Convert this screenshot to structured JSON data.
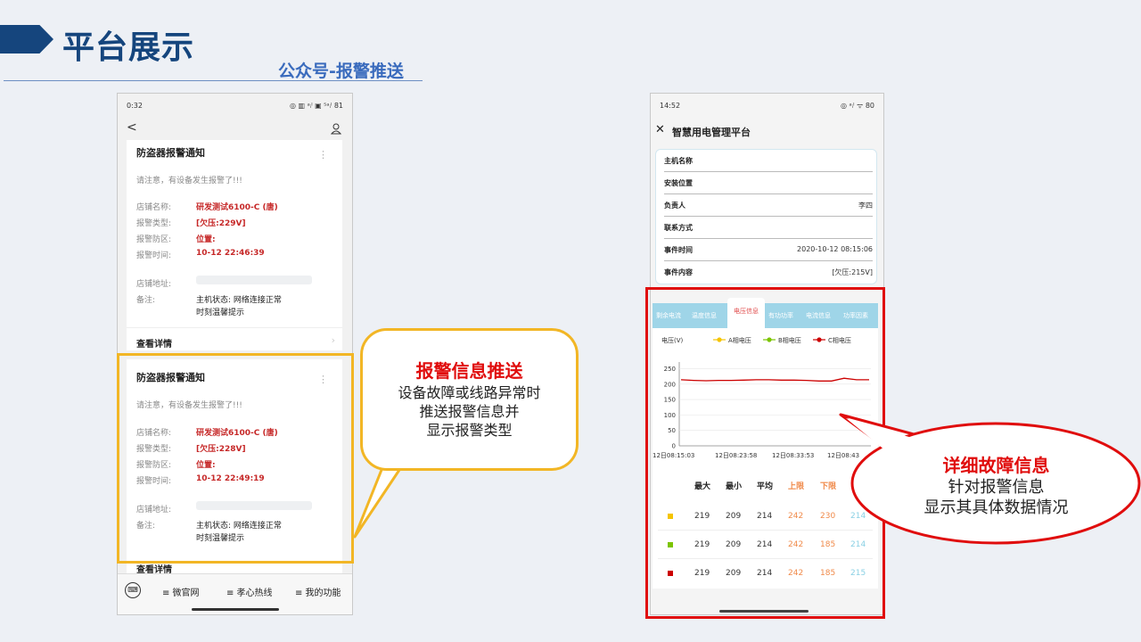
{
  "header": {
    "title": "平台展示",
    "subtitle": "公众号-报警推送"
  },
  "phone1": {
    "status_time": "0:32",
    "status_icons": "◎ ▥ ᵃᵢˡ ▣ ⁵ᵃᵢˡ 81",
    "back": "<",
    "cards": [
      {
        "title": "防盗器报警通知",
        "intro": "请注意，有设备发生报警了!!!",
        "labels": [
          "店铺名称:",
          "报警类型:",
          "报警防区:",
          "报警时间:",
          "店铺地址:",
          "备注:"
        ],
        "shop": "研发测试6100-C (唐)",
        "type": "[欠压:229V]",
        "zone": "位置:",
        "time": "10-12 22:46:39",
        "note1": "主机状态: 网络连接正常",
        "note2": "时刻温馨提示",
        "detail": "查看详情"
      },
      {
        "title": "防盗器报警通知",
        "intro": "请注意，有设备发生报警了!!!",
        "labels": [
          "店铺名称:",
          "报警类型:",
          "报警防区:",
          "报警时间:",
          "店铺地址:",
          "备注:"
        ],
        "shop": "研发测试6100-C (唐)",
        "type": "[欠压:228V]",
        "zone": "位置:",
        "time": "10-12 22:49:19",
        "note1": "主机状态: 网络连接正常",
        "note2": "时刻温馨提示",
        "detail": "查看详情"
      }
    ],
    "menu": [
      "≡ 微官网",
      "≡ 孝心热线",
      "≡ 我的功能"
    ]
  },
  "callout1": {
    "title": "报警信息推送",
    "lines": [
      "设备故障或线路异常时",
      "推送报警信息并",
      "显示报警类型"
    ]
  },
  "phone2": {
    "status_time": "14:52",
    "status_icons": "◎ ᵃᵢˡ ᯤ 80",
    "nav_title": "智慧用电管理平台",
    "info": [
      {
        "key": "主机名称",
        "value": ""
      },
      {
        "key": "安装位置",
        "value": ""
      },
      {
        "key": "负责人",
        "value": "李四"
      },
      {
        "key": "联系方式",
        "value": ""
      },
      {
        "key": "事件时间",
        "value": "2020-10-12 08:15:06"
      },
      {
        "key": "事件内容",
        "value": "[欠压:215V]"
      }
    ],
    "tabs": [
      "剩余电流",
      "温度信息",
      "电压信息",
      "有功功率",
      "电流信息",
      "功率因素"
    ],
    "active_tab": "电压信息",
    "table_headers": [
      "最大",
      "最小",
      "平均",
      "上限",
      "下限"
    ],
    "table_rows": [
      {
        "color": "#f5c400",
        "values": [
          "219",
          "209",
          "214",
          "242",
          "230",
          "214"
        ]
      },
      {
        "color": "#7cc400",
        "values": [
          "219",
          "209",
          "214",
          "242",
          "185",
          "214"
        ]
      },
      {
        "color": "#cc0000",
        "values": [
          "219",
          "209",
          "214",
          "242",
          "185",
          "215"
        ]
      }
    ]
  },
  "chart_data": {
    "type": "line",
    "ylabel": "电压(V)",
    "legend": [
      "A相电压",
      "B相电压",
      "C相电压"
    ],
    "series_colors": [
      "#f5c400",
      "#7cc400",
      "#cc0000"
    ],
    "x_ticks": [
      "12日08:15:03",
      "12日08:23:58",
      "12日08:33:53",
      "12日08:43"
    ],
    "y_ticks": [
      0,
      50,
      100,
      150,
      200,
      250
    ],
    "ylim": [
      0,
      260
    ],
    "series": [
      {
        "name": "C相电压",
        "values": [
          214,
          212,
          211,
          212,
          212,
          213,
          214,
          214,
          213,
          213,
          212,
          210,
          210,
          219,
          214,
          214
        ]
      }
    ]
  },
  "callout2": {
    "title": "详细故障信息",
    "lines": [
      "针对报警信息",
      "显示其具体数据情况"
    ]
  }
}
